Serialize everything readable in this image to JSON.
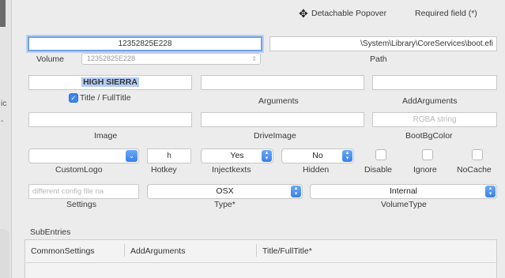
{
  "header": {
    "detachable_label": "Detachable Popover",
    "required_label": "Required field (*)"
  },
  "volume": {
    "value": "12352825E228",
    "label": "Volume",
    "popup_value": "12352825E228"
  },
  "path": {
    "value": "\\System\\Library\\CoreServices\\boot.efi",
    "label": "Path"
  },
  "title": {
    "value": "HIGH SIERRA",
    "checkbox_label": "Title / FullTitle"
  },
  "arguments": {
    "value": "",
    "label": "Arguments"
  },
  "add_arguments": {
    "value": "",
    "label": "AddArguments"
  },
  "image": {
    "value": "",
    "label": "Image"
  },
  "drive_image": {
    "value": "",
    "label": "DriveImage"
  },
  "boot_bg_color": {
    "placeholder": "RGBA string",
    "label": "BootBgColor"
  },
  "custom_logo": {
    "label": "CustomLogo"
  },
  "hotkey": {
    "value": "h",
    "label": "Hotkey"
  },
  "inject_kexts": {
    "value": "Yes",
    "label": "Injectkexts"
  },
  "hidden": {
    "value": "No",
    "label": "Hidden"
  },
  "disable": {
    "label": "Disable"
  },
  "ignore": {
    "label": "Ignore"
  },
  "nocache": {
    "label": "NoCache"
  },
  "settings": {
    "placeholder": "different config file na",
    "label": "Settings"
  },
  "type": {
    "value": "OSX",
    "label": "Type*"
  },
  "volume_type": {
    "value": "Internal",
    "label": "VolumeType"
  },
  "subentries": {
    "label": "SubEntries",
    "columns": [
      "CommonSettings",
      "AddArguments",
      "Title/FullTitle*"
    ]
  },
  "left_edge": {
    "glyph1": "ic",
    "glyph2": "-"
  },
  "colors": {
    "accent": "#3a85f0",
    "focus_ring": "#6ea2e9",
    "background": "#ececec"
  },
  "icons": {
    "detachable": "move-cross-icon",
    "stepper": "up-down-stepper-icon"
  }
}
